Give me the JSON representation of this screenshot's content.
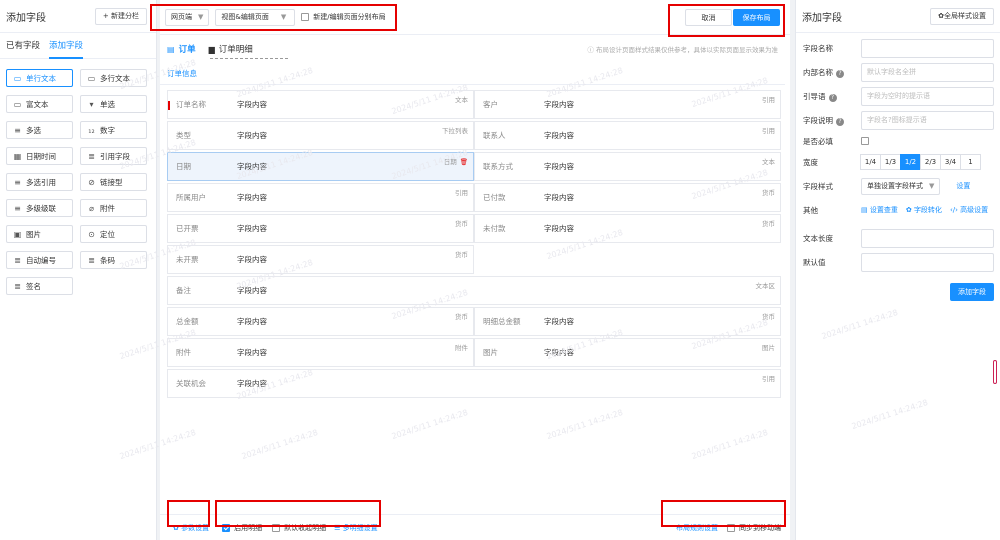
{
  "left": {
    "title": "添加字段",
    "new_column_btn": "+ 新建分栏",
    "tabs": [
      "已有字段",
      "添加字段"
    ],
    "fields": [
      {
        "label": "单行文本",
        "icon": "text-box-icon",
        "glyph": "▭",
        "selected": true
      },
      {
        "label": "多行文本",
        "icon": "textarea-icon",
        "glyph": "▭"
      },
      {
        "label": "富文本",
        "icon": "rich-text-icon",
        "glyph": "▭"
      },
      {
        "label": "单选",
        "icon": "dropdown-icon",
        "glyph": "▾"
      },
      {
        "label": "多选",
        "icon": "multi-select-icon",
        "glyph": "≡"
      },
      {
        "label": "数字",
        "icon": "number-icon",
        "glyph": "₁₂"
      },
      {
        "label": "日期时间",
        "icon": "calendar-icon",
        "glyph": "▦"
      },
      {
        "label": "引用字段",
        "icon": "reference-icon",
        "glyph": "≣"
      },
      {
        "label": "多选引用",
        "icon": "multi-ref-icon",
        "glyph": "≡"
      },
      {
        "label": "链接型",
        "icon": "link-icon",
        "glyph": "⊘"
      },
      {
        "label": "多级级联",
        "icon": "cascade-icon",
        "glyph": "≡"
      },
      {
        "label": "附件",
        "icon": "attachment-icon",
        "glyph": "⌀"
      },
      {
        "label": "图片",
        "icon": "image-icon",
        "glyph": "▣"
      },
      {
        "label": "定位",
        "icon": "location-icon",
        "glyph": "⊙"
      },
      {
        "label": "自动编号",
        "icon": "auto-number-icon",
        "glyph": "≣"
      },
      {
        "label": "条码",
        "icon": "barcode-icon",
        "glyph": "≣"
      },
      {
        "label": "签名",
        "icon": "signature-icon",
        "glyph": "≣"
      }
    ]
  },
  "toolbar": {
    "device_select": "网页端",
    "view_select": "视图&编辑页面",
    "split_layout_label": "新建/编辑页面分别布局",
    "cancel": "取消",
    "save": "保存布局"
  },
  "form": {
    "tabs": [
      "订单",
      "订单明细"
    ],
    "hint": "布局设计页面样式结果仅供参考，具体以实际页面显示效果为准",
    "section": "订单信息",
    "field_value": "字段内容",
    "rows": [
      [
        {
          "label": "订单名称",
          "tag": "文本",
          "required": true
        },
        {
          "label": "客户",
          "tag": "引用"
        }
      ],
      [
        {
          "label": "类型",
          "tag": "下拉列表"
        },
        {
          "label": "联系人",
          "tag": "引用"
        }
      ],
      [
        {
          "label": "日期",
          "tag": "日期",
          "highlight": true,
          "trash": true
        },
        {
          "label": "联系方式",
          "tag": "文本"
        }
      ],
      [
        {
          "label": "所属用户",
          "tag": "引用"
        },
        {
          "label": "已付款",
          "tag": "货币"
        }
      ],
      [
        {
          "label": "已开票",
          "tag": "货币"
        },
        {
          "label": "未付款",
          "tag": "货币"
        }
      ],
      [
        {
          "label": "未开票",
          "tag": "货币"
        }
      ],
      [
        {
          "label": "备注",
          "tag": "文本区",
          "full": true
        }
      ],
      [
        {
          "label": "总金额",
          "tag": "货币"
        },
        {
          "label": "明细总金额",
          "tag": "货币"
        }
      ],
      [
        {
          "label": "附件",
          "tag": "附件"
        },
        {
          "label": "图片",
          "tag": "图片"
        }
      ],
      [
        {
          "label": "关联机会",
          "tag": "引用",
          "full": true
        }
      ]
    ]
  },
  "footer": {
    "param_settings": "参数设置",
    "enable_detail": "启用明细",
    "collapse_detail": "默认收起明细",
    "multi_detail_settings": "多明细设置",
    "layout_rule_settings": "布局规则设置",
    "sync_mobile": "同步到移动端"
  },
  "right": {
    "title": "添加字段",
    "global_style_btn": "全局样式设置",
    "props": {
      "field_name": "字段名称",
      "internal_name": "内部名称",
      "internal_ph": "默认字段名全拼",
      "guide": "引导语",
      "guide_ph": "字段为空时的提示语",
      "desc": "字段说明",
      "desc_ph": "字段名?图标提示语",
      "required": "是否必填",
      "width": "宽度",
      "width_opts": [
        "1/4",
        "1/3",
        "1/2",
        "2/3",
        "3/4",
        "1"
      ],
      "style": "字段样式",
      "style_select": "单独设置字段样式",
      "style_settings": "设置",
      "other": "其他",
      "other_links": [
        "设置查重",
        "字段转化",
        "高级设置"
      ],
      "text_length": "文本长度",
      "default_value": "默认值",
      "add_field_btn": "添加字段"
    }
  },
  "watermark": "2024/5/11 14:24:28",
  "colors": {
    "primary": "#1890ff",
    "highlight_box": "#e50000"
  }
}
